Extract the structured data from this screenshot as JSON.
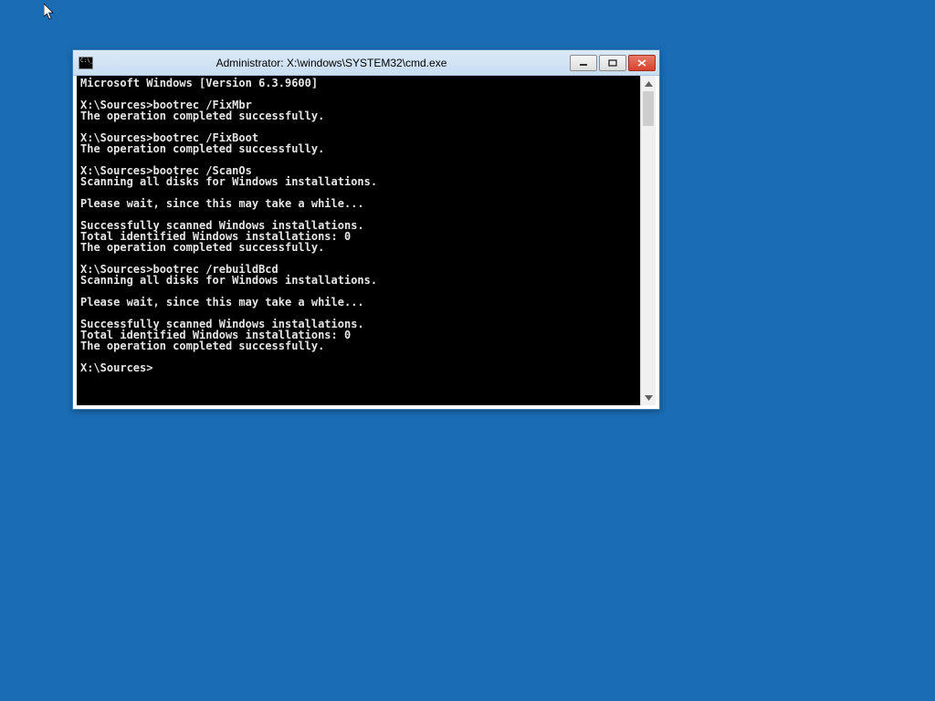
{
  "window": {
    "title": "Administrator: X:\\windows\\SYSTEM32\\cmd.exe"
  },
  "terminal": {
    "lines": [
      "Microsoft Windows [Version 6.3.9600]",
      "",
      "X:\\Sources>bootrec /FixMbr",
      "The operation completed successfully.",
      "",
      "X:\\Sources>bootrec /FixBoot",
      "The operation completed successfully.",
      "",
      "X:\\Sources>bootrec /ScanOs",
      "Scanning all disks for Windows installations.",
      "",
      "Please wait, since this may take a while...",
      "",
      "Successfully scanned Windows installations.",
      "Total identified Windows installations: 0",
      "The operation completed successfully.",
      "",
      "X:\\Sources>bootrec /rebuildBcd",
      "Scanning all disks for Windows installations.",
      "",
      "Please wait, since this may take a while...",
      "",
      "Successfully scanned Windows installations.",
      "Total identified Windows installations: 0",
      "The operation completed successfully.",
      "",
      "X:\\Sources>"
    ]
  }
}
